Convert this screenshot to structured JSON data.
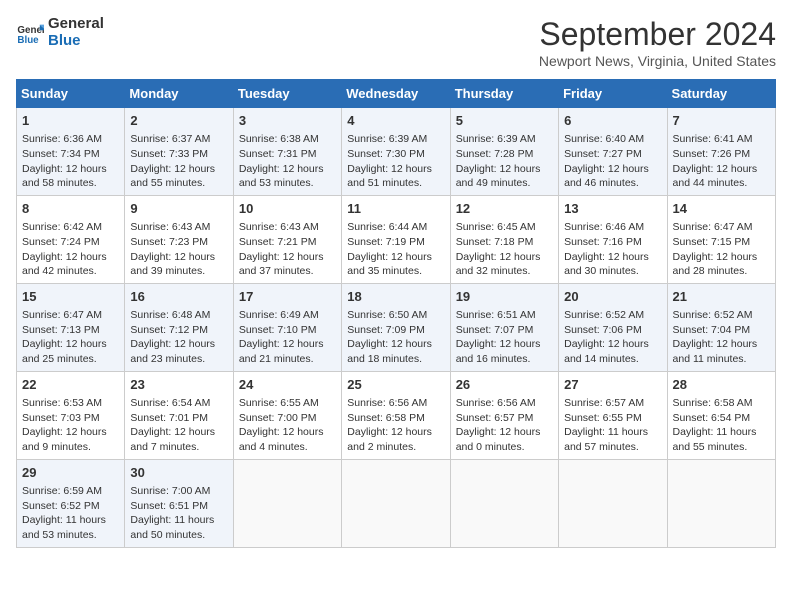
{
  "logo": {
    "line1": "General",
    "line2": "Blue"
  },
  "title": "September 2024",
  "location": "Newport News, Virginia, United States",
  "days_of_week": [
    "Sunday",
    "Monday",
    "Tuesday",
    "Wednesday",
    "Thursday",
    "Friday",
    "Saturday"
  ],
  "weeks": [
    [
      {
        "day": "1",
        "info": "Sunrise: 6:36 AM\nSunset: 7:34 PM\nDaylight: 12 hours\nand 58 minutes."
      },
      {
        "day": "2",
        "info": "Sunrise: 6:37 AM\nSunset: 7:33 PM\nDaylight: 12 hours\nand 55 minutes."
      },
      {
        "day": "3",
        "info": "Sunrise: 6:38 AM\nSunset: 7:31 PM\nDaylight: 12 hours\nand 53 minutes."
      },
      {
        "day": "4",
        "info": "Sunrise: 6:39 AM\nSunset: 7:30 PM\nDaylight: 12 hours\nand 51 minutes."
      },
      {
        "day": "5",
        "info": "Sunrise: 6:39 AM\nSunset: 7:28 PM\nDaylight: 12 hours\nand 49 minutes."
      },
      {
        "day": "6",
        "info": "Sunrise: 6:40 AM\nSunset: 7:27 PM\nDaylight: 12 hours\nand 46 minutes."
      },
      {
        "day": "7",
        "info": "Sunrise: 6:41 AM\nSunset: 7:26 PM\nDaylight: 12 hours\nand 44 minutes."
      }
    ],
    [
      {
        "day": "8",
        "info": "Sunrise: 6:42 AM\nSunset: 7:24 PM\nDaylight: 12 hours\nand 42 minutes."
      },
      {
        "day": "9",
        "info": "Sunrise: 6:43 AM\nSunset: 7:23 PM\nDaylight: 12 hours\nand 39 minutes."
      },
      {
        "day": "10",
        "info": "Sunrise: 6:43 AM\nSunset: 7:21 PM\nDaylight: 12 hours\nand 37 minutes."
      },
      {
        "day": "11",
        "info": "Sunrise: 6:44 AM\nSunset: 7:19 PM\nDaylight: 12 hours\nand 35 minutes."
      },
      {
        "day": "12",
        "info": "Sunrise: 6:45 AM\nSunset: 7:18 PM\nDaylight: 12 hours\nand 32 minutes."
      },
      {
        "day": "13",
        "info": "Sunrise: 6:46 AM\nSunset: 7:16 PM\nDaylight: 12 hours\nand 30 minutes."
      },
      {
        "day": "14",
        "info": "Sunrise: 6:47 AM\nSunset: 7:15 PM\nDaylight: 12 hours\nand 28 minutes."
      }
    ],
    [
      {
        "day": "15",
        "info": "Sunrise: 6:47 AM\nSunset: 7:13 PM\nDaylight: 12 hours\nand 25 minutes."
      },
      {
        "day": "16",
        "info": "Sunrise: 6:48 AM\nSunset: 7:12 PM\nDaylight: 12 hours\nand 23 minutes."
      },
      {
        "day": "17",
        "info": "Sunrise: 6:49 AM\nSunset: 7:10 PM\nDaylight: 12 hours\nand 21 minutes."
      },
      {
        "day": "18",
        "info": "Sunrise: 6:50 AM\nSunset: 7:09 PM\nDaylight: 12 hours\nand 18 minutes."
      },
      {
        "day": "19",
        "info": "Sunrise: 6:51 AM\nSunset: 7:07 PM\nDaylight: 12 hours\nand 16 minutes."
      },
      {
        "day": "20",
        "info": "Sunrise: 6:52 AM\nSunset: 7:06 PM\nDaylight: 12 hours\nand 14 minutes."
      },
      {
        "day": "21",
        "info": "Sunrise: 6:52 AM\nSunset: 7:04 PM\nDaylight: 12 hours\nand 11 minutes."
      }
    ],
    [
      {
        "day": "22",
        "info": "Sunrise: 6:53 AM\nSunset: 7:03 PM\nDaylight: 12 hours\nand 9 minutes."
      },
      {
        "day": "23",
        "info": "Sunrise: 6:54 AM\nSunset: 7:01 PM\nDaylight: 12 hours\nand 7 minutes."
      },
      {
        "day": "24",
        "info": "Sunrise: 6:55 AM\nSunset: 7:00 PM\nDaylight: 12 hours\nand 4 minutes."
      },
      {
        "day": "25",
        "info": "Sunrise: 6:56 AM\nSunset: 6:58 PM\nDaylight: 12 hours\nand 2 minutes."
      },
      {
        "day": "26",
        "info": "Sunrise: 6:56 AM\nSunset: 6:57 PM\nDaylight: 12 hours\nand 0 minutes."
      },
      {
        "day": "27",
        "info": "Sunrise: 6:57 AM\nSunset: 6:55 PM\nDaylight: 11 hours\nand 57 minutes."
      },
      {
        "day": "28",
        "info": "Sunrise: 6:58 AM\nSunset: 6:54 PM\nDaylight: 11 hours\nand 55 minutes."
      }
    ],
    [
      {
        "day": "29",
        "info": "Sunrise: 6:59 AM\nSunset: 6:52 PM\nDaylight: 11 hours\nand 53 minutes."
      },
      {
        "day": "30",
        "info": "Sunrise: 7:00 AM\nSunset: 6:51 PM\nDaylight: 11 hours\nand 50 minutes."
      },
      {
        "day": "",
        "info": ""
      },
      {
        "day": "",
        "info": ""
      },
      {
        "day": "",
        "info": ""
      },
      {
        "day": "",
        "info": ""
      },
      {
        "day": "",
        "info": ""
      }
    ]
  ]
}
